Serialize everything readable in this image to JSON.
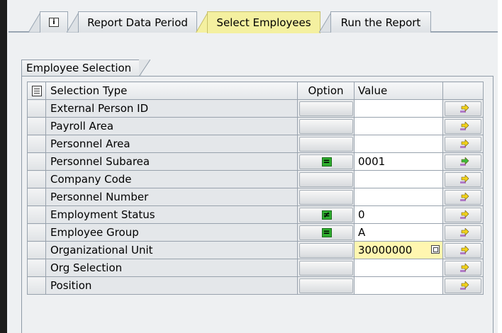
{
  "tabs": [
    {
      "label": "",
      "icon": "info-icon"
    },
    {
      "label": "Report Data Period"
    },
    {
      "label": "Select Employees",
      "active": true
    },
    {
      "label": "Run the Report"
    }
  ],
  "group": {
    "title": "Employee Selection"
  },
  "table": {
    "columns": {
      "type": "Selection Type",
      "option": "Option",
      "value": "Value"
    },
    "rows": [
      {
        "type": "External Person ID",
        "option": "",
        "value": ""
      },
      {
        "type": "Payroll Area",
        "option": "",
        "value": ""
      },
      {
        "type": "Personnel Area",
        "option": "",
        "value": ""
      },
      {
        "type": "Personnel Subarea",
        "option": "=",
        "value": "0001",
        "filled": true
      },
      {
        "type": "Company Code",
        "option": "",
        "value": ""
      },
      {
        "type": "Personnel Number",
        "option": "",
        "value": ""
      },
      {
        "type": "Employment Status",
        "option": "≠",
        "value": "0"
      },
      {
        "type": "Employee Group",
        "option": "=",
        "value": "A"
      },
      {
        "type": "Organizational Unit",
        "option": "",
        "value": "30000000",
        "focused": true
      },
      {
        "type": "Org Selection",
        "option": "",
        "value": ""
      },
      {
        "type": "Position",
        "option": "",
        "value": ""
      }
    ]
  },
  "colors": {
    "active_tab": "#f4f0a0",
    "option_green": "#2fae2f",
    "focused_field": "#fff6b0",
    "arrow_yellow": "#f2d21a",
    "arrow_green": "#3dbb3d",
    "arrow_purple": "#b07ac8"
  }
}
